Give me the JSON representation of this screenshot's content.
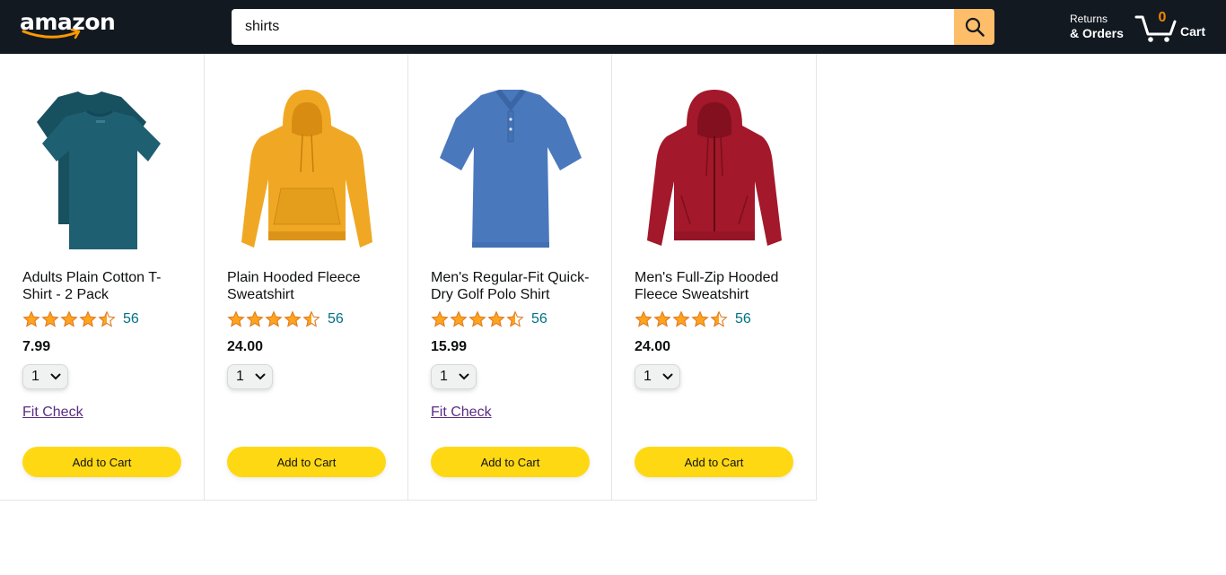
{
  "header": {
    "logo_text": "amazon",
    "search": {
      "value": "shirts",
      "placeholder": ""
    },
    "returns": {
      "line1": "Returns",
      "line2": "& Orders"
    },
    "cart": {
      "count": "0",
      "label": "Cart"
    }
  },
  "colors": {
    "header_bg": "#131921",
    "search_button": "#febd69",
    "cart_count": "#f08804",
    "add_to_cart": "#ffd814",
    "star": "#de7921",
    "rating_link": "#007185",
    "fit_link": "#5b2c83"
  },
  "products": [
    {
      "name": "Adults Plain Cotton T-Shirt - 2 Pack",
      "rating_stars": 4.5,
      "rating_count": "56",
      "price": "7.99",
      "quantity": "1",
      "fit_check": "Fit Check",
      "add_label": "Add to Cart",
      "image": "teal-tshirt-2pack",
      "color": "#1f5f72"
    },
    {
      "name": "Plain Hooded Fleece Sweatshirt",
      "rating_stars": 4.5,
      "rating_count": "56",
      "price": "24.00",
      "quantity": "1",
      "fit_check": "",
      "add_label": "Add to Cart",
      "image": "yellow-hoodie",
      "color": "#f0a824"
    },
    {
      "name": "Men's Regular-Fit Quick-Dry Golf Polo Shirt",
      "rating_stars": 4.5,
      "rating_count": "56",
      "price": "15.99",
      "quantity": "1",
      "fit_check": "Fit Check",
      "add_label": "Add to Cart",
      "image": "blue-polo-shirt",
      "color": "#4a78bd"
    },
    {
      "name": "Men's Full-Zip Hooded Fleece Sweatshirt",
      "rating_stars": 4.5,
      "rating_count": "56",
      "price": "24.00",
      "quantity": "1",
      "fit_check": "",
      "add_label": "Add to Cart",
      "image": "red-zip-hoodie",
      "color": "#a3182a"
    }
  ]
}
